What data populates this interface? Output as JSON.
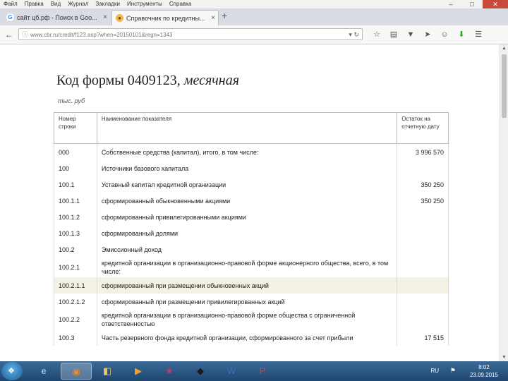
{
  "menu": [
    "Файл",
    "Правка",
    "Вид",
    "Журнал",
    "Закладки",
    "Инструменты",
    "Справка"
  ],
  "tabs": [
    {
      "label": "сайт цб.рф - Поиск в Goo...",
      "icon": "google-icon"
    },
    {
      "label": "Справочник по кредитны...",
      "icon": "cbr-icon"
    }
  ],
  "newtab_label": "+",
  "url": "www.cbr.ru/credit/f123.asp?when=20150101&regn=1343",
  "page": {
    "title_main": "Код формы 0409123,",
    "title_italic": " месячная",
    "units": "тыс. руб",
    "headers": [
      "Номер строки",
      "Наименование показателя",
      "Остаток на отчетную дату"
    ]
  },
  "rows": [
    {
      "num": "000",
      "name": "Собственные средства (капитал), итого, в том числе:",
      "value": "3 996 570"
    },
    {
      "num": "100",
      "name": "Источники базового капитала",
      "value": ""
    },
    {
      "num": "100.1",
      "name": "Уставный капитал кредитной организации",
      "value": "350 250"
    },
    {
      "num": "100.1.1",
      "name": "сформированный обыкновенными акциями",
      "value": "350 250"
    },
    {
      "num": "100.1.2",
      "name": "сформированный привилегированными акциями",
      "value": ""
    },
    {
      "num": "100.1.3",
      "name": "сформированный долями",
      "value": ""
    },
    {
      "num": "100.2",
      "name": "Эмиссионный доход",
      "value": ""
    },
    {
      "num": "100.2.1",
      "name": "кредитной организации в организационно-правовой форме акционерного общества, всего, в том числе:",
      "value": ""
    },
    {
      "num": "100.2.1.1",
      "name": "сформированный при размещении обыкновенных акций",
      "value": ""
    },
    {
      "num": "100.2.1.2",
      "name": "сформированный при размещении привилегированных акций",
      "value": ""
    },
    {
      "num": "100.2.2",
      "name": "кредитной организации в организационно-правовой форме общества с ограниченной ответственностью",
      "value": ""
    },
    {
      "num": "100.3",
      "name": "Часть резервного фонда кредитной организации, сформированного за счет прибыли",
      "value": "17 515"
    }
  ],
  "tray": {
    "lang": "RU",
    "time": "8:02",
    "date": "23.09.2015"
  }
}
